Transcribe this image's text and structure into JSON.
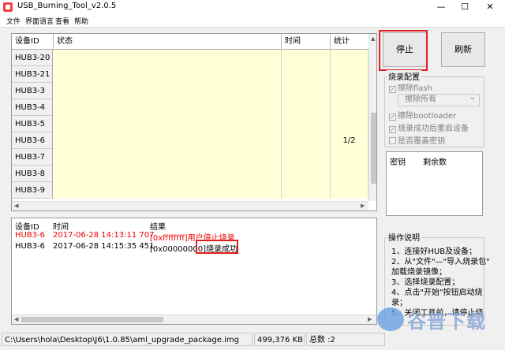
{
  "window": {
    "title": "USB_Burning_Tool_v2.0.5",
    "minimize": "—",
    "maximize": "☐",
    "close": "✕"
  },
  "menu": [
    "文件",
    "界面语言",
    "查看",
    "帮助"
  ],
  "grid": {
    "columns": [
      "设备ID",
      "状态",
      "时间",
      "统计"
    ],
    "rows": [
      {
        "id": "HUB3-20",
        "status": "",
        "time": "",
        "stat": ""
      },
      {
        "id": "HUB3-21",
        "status": "",
        "time": "",
        "stat": ""
      },
      {
        "id": "HUB3-3",
        "status": "",
        "time": "",
        "stat": ""
      },
      {
        "id": "HUB3-4",
        "status": "",
        "time": "",
        "stat": ""
      },
      {
        "id": "HUB3-5",
        "status": "",
        "time": "",
        "stat": ""
      },
      {
        "id": "HUB3-6",
        "status": "",
        "time": "",
        "stat": "1/2"
      },
      {
        "id": "HUB3-7",
        "status": "",
        "time": "",
        "stat": ""
      },
      {
        "id": "HUB3-8",
        "status": "",
        "time": "",
        "stat": ""
      },
      {
        "id": "HUB3-9",
        "status": "",
        "time": "",
        "stat": ""
      }
    ]
  },
  "log": {
    "columns": [
      "设备ID",
      "时间",
      "结果"
    ],
    "rows": [
      {
        "id": "HUB3-6",
        "time": "2017-06-28 14:13:11 707",
        "result": "[0xffffffff]用户停止烧录",
        "error": true
      },
      {
        "id": "HUB3-6",
        "time": "2017-06-28 14:15:35 451",
        "result": "[0x00000000]烧录成功",
        "error": false
      }
    ]
  },
  "buttons": {
    "stop": "停止",
    "refresh": "刷新"
  },
  "burn_config": {
    "title": "烧录配置",
    "erase_flash": "擦除flash",
    "erase_mode": "擦除所有",
    "erase_bootloader": "擦除bootloader",
    "reboot_after": "烧录成功后重启设备",
    "overwrite_key": "是否覆盖密钥"
  },
  "keys": {
    "columns": [
      "密钥",
      "剩余数"
    ]
  },
  "help": {
    "title": "操作说明",
    "lines": [
      "1、连接好HUB及设备；",
      "2、从\"文件\"—\"导入烧录包\"",
      "加载烧录镜像；",
      "3、选择烧录配置；",
      "4、点击\"开始\"按钮启动烧",
      "录；",
      "5、关闭工具前，请停止烧"
    ]
  },
  "status": {
    "path": "C:\\Users\\hola\\Desktop\\J6\\1.0.85\\aml_upgrade_package.img",
    "size": "499,376 KB",
    "total": "总数 :2"
  },
  "watermark": "谷普下载",
  "colors": {
    "grid_cell": "#ffffd8",
    "error_text": "#e00000",
    "highlight": "#e02020"
  }
}
